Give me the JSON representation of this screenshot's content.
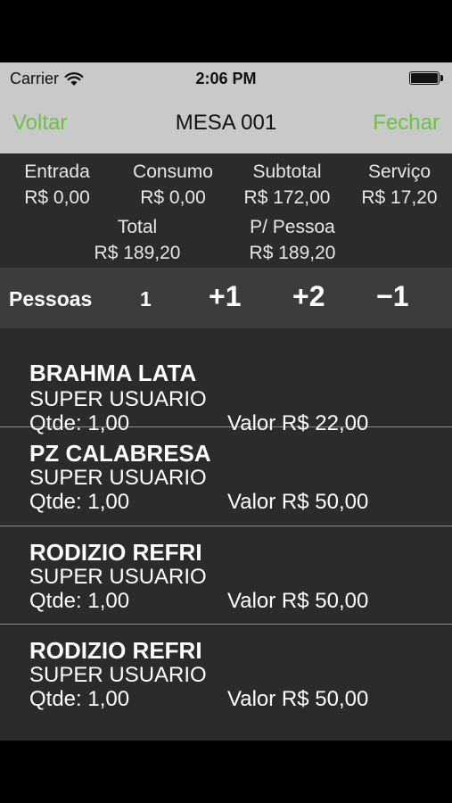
{
  "status_bar": {
    "carrier": "Carrier",
    "time": "2:06 PM"
  },
  "nav": {
    "back_label": "Voltar",
    "title": "MESA 001",
    "close_label": "Fechar"
  },
  "summary": {
    "entrada": {
      "label": "Entrada",
      "value": "R$ 0,00"
    },
    "consumo": {
      "label": "Consumo",
      "value": "R$ 0,00"
    },
    "subtotal": {
      "label": "Subtotal",
      "value": "R$ 172,00"
    },
    "servico": {
      "label": "Serviço",
      "value": "R$ 17,20"
    },
    "total": {
      "label": "Total",
      "value": "R$ 189,20"
    },
    "por_pessoa": {
      "label": "P/ Pessoa",
      "value": "R$ 189,20"
    }
  },
  "people": {
    "label": "Pessoas",
    "count": "1",
    "plus1": "+1",
    "plus2": "+2",
    "minus1": "−1"
  },
  "items": [
    {
      "name": "BRAHMA LATA",
      "user": "SUPER USUARIO",
      "qty": "Qtde: 1,00",
      "valor": "Valor R$ 22,00"
    },
    {
      "name": "PZ CALABRESA",
      "user": "SUPER USUARIO",
      "qty": "Qtde: 1,00",
      "valor": "Valor R$ 50,00"
    },
    {
      "name": "RODIZIO REFRI",
      "user": "SUPER USUARIO",
      "qty": "Qtde: 1,00",
      "valor": "Valor R$ 50,00"
    },
    {
      "name": "RODIZIO REFRI",
      "user": "SUPER USUARIO",
      "qty": "Qtde: 1,00",
      "valor": "Valor R$ 50,00"
    }
  ],
  "colors": {
    "accent": "#6cc241",
    "navbar": "#c9c9c9",
    "background": "#2b2b2b",
    "people_bar": "#3c3c3c"
  }
}
